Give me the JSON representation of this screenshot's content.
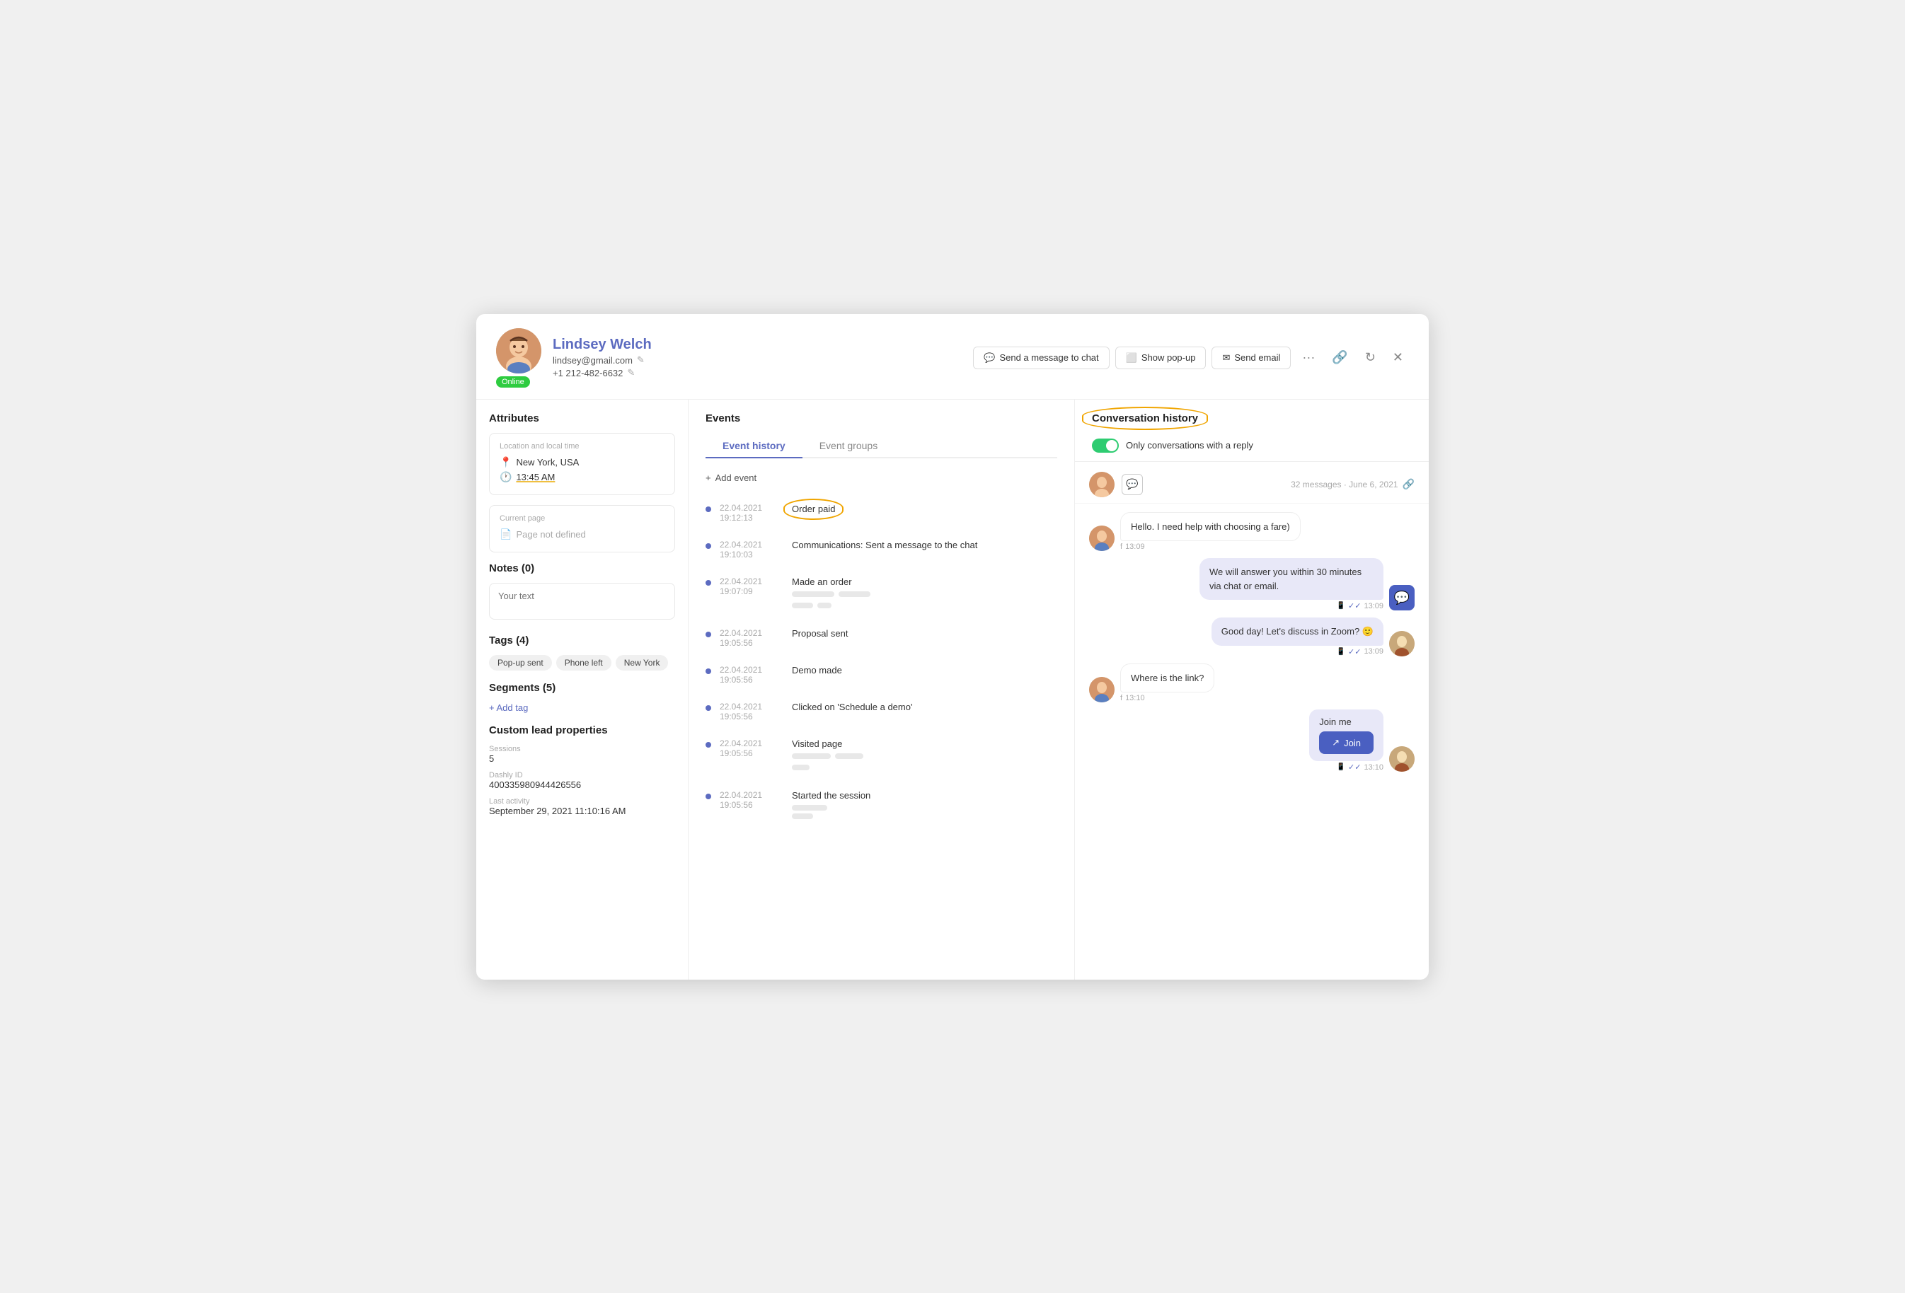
{
  "header": {
    "user_name": "Lindsey Welch",
    "email": "lindsey@gmail.com",
    "phone": "+1 212-482-6632",
    "status": "Online",
    "btn_send_message": "Send a message to chat",
    "btn_show_popup": "Show pop-up",
    "btn_send_email": "Send email"
  },
  "attributes": {
    "title": "Attributes",
    "location_label": "Location and local time",
    "location": "New York, USA",
    "time": "13:45 AM",
    "current_page_label": "Current page",
    "current_page": "Page not defined",
    "notes_title": "Notes (0)",
    "notes_placeholder": "Your text",
    "tags_title": "Tags (4)",
    "tags": [
      "Pop-up sent",
      "Phone left",
      "New York"
    ],
    "segments_title": "Segments (5)",
    "add_tag": "+ Add tag",
    "custom_props_title": "Custom lead properties",
    "sessions_label": "Sessions",
    "sessions_value": "5",
    "dashly_id_label": "Dashly ID",
    "dashly_id_value": "400335980944426556",
    "last_activity_label": "Last activity",
    "last_activity_value": "September 29, 2021 11:10:16 AM"
  },
  "events": {
    "title": "Events",
    "tab_history": "Event history",
    "tab_groups": "Event groups",
    "add_event": "+ Add event",
    "items": [
      {
        "date": "22.04.2021",
        "time": "19:12:13",
        "name": "Order paid",
        "has_oval": true,
        "has_skeleton": false
      },
      {
        "date": "22.04.2021",
        "time": "19:10:03",
        "name": "Communications: Sent a message to the chat",
        "has_oval": false,
        "has_skeleton": false
      },
      {
        "date": "22.04.2021",
        "time": "19:07:09",
        "name": "Made an order",
        "has_oval": false,
        "has_skeleton": true,
        "skeleton_lines": [
          60,
          45,
          30,
          20
        ]
      },
      {
        "date": "22.04.2021",
        "time": "19:05:56",
        "name": "Proposal sent",
        "has_oval": false,
        "has_skeleton": false
      },
      {
        "date": "22.04.2021",
        "time": "19:05:56",
        "name": "Demo made",
        "has_oval": false,
        "has_skeleton": false
      },
      {
        "date": "22.04.2021",
        "time": "19:05:56",
        "name": "Clicked on 'Schedule a demo'",
        "has_oval": false,
        "has_skeleton": false
      },
      {
        "date": "22.04.2021",
        "time": "19:05:56",
        "name": "Visited page",
        "has_oval": false,
        "has_skeleton": true,
        "skeleton_lines": [
          55,
          40,
          25
        ]
      },
      {
        "date": "22.04.2021",
        "time": "19:05:56",
        "name": "Started the session",
        "has_oval": false,
        "has_skeleton": true,
        "skeleton_lines": [
          50,
          30
        ]
      }
    ]
  },
  "conversation": {
    "title": "Conversation history",
    "toggle_label": "Only conversations with a reply",
    "meta": "32 messages · June 6, 2021",
    "messages": [
      {
        "id": 1,
        "side": "left",
        "text": "Hello. I need help with choosing a fare)",
        "time": "13:09",
        "platform": "f",
        "avatar": "female"
      },
      {
        "id": 2,
        "side": "right",
        "text": "We will answer you within 30 minutes via chat or email.",
        "time": "13:09",
        "double_check": true,
        "avatar": "bot"
      },
      {
        "id": 3,
        "side": "right",
        "text": "Good day! Let's discuss in Zoom? 🙂",
        "time": "13:09",
        "double_check": true,
        "avatar": "male1"
      },
      {
        "id": 4,
        "side": "left",
        "text": "Where is the link?",
        "time": "13:10",
        "platform": "f",
        "avatar": "female"
      },
      {
        "id": 5,
        "side": "right",
        "text": "Join me",
        "time": "13:10",
        "double_check": true,
        "avatar": "male1",
        "has_join_btn": true,
        "join_label": "Join"
      }
    ]
  }
}
